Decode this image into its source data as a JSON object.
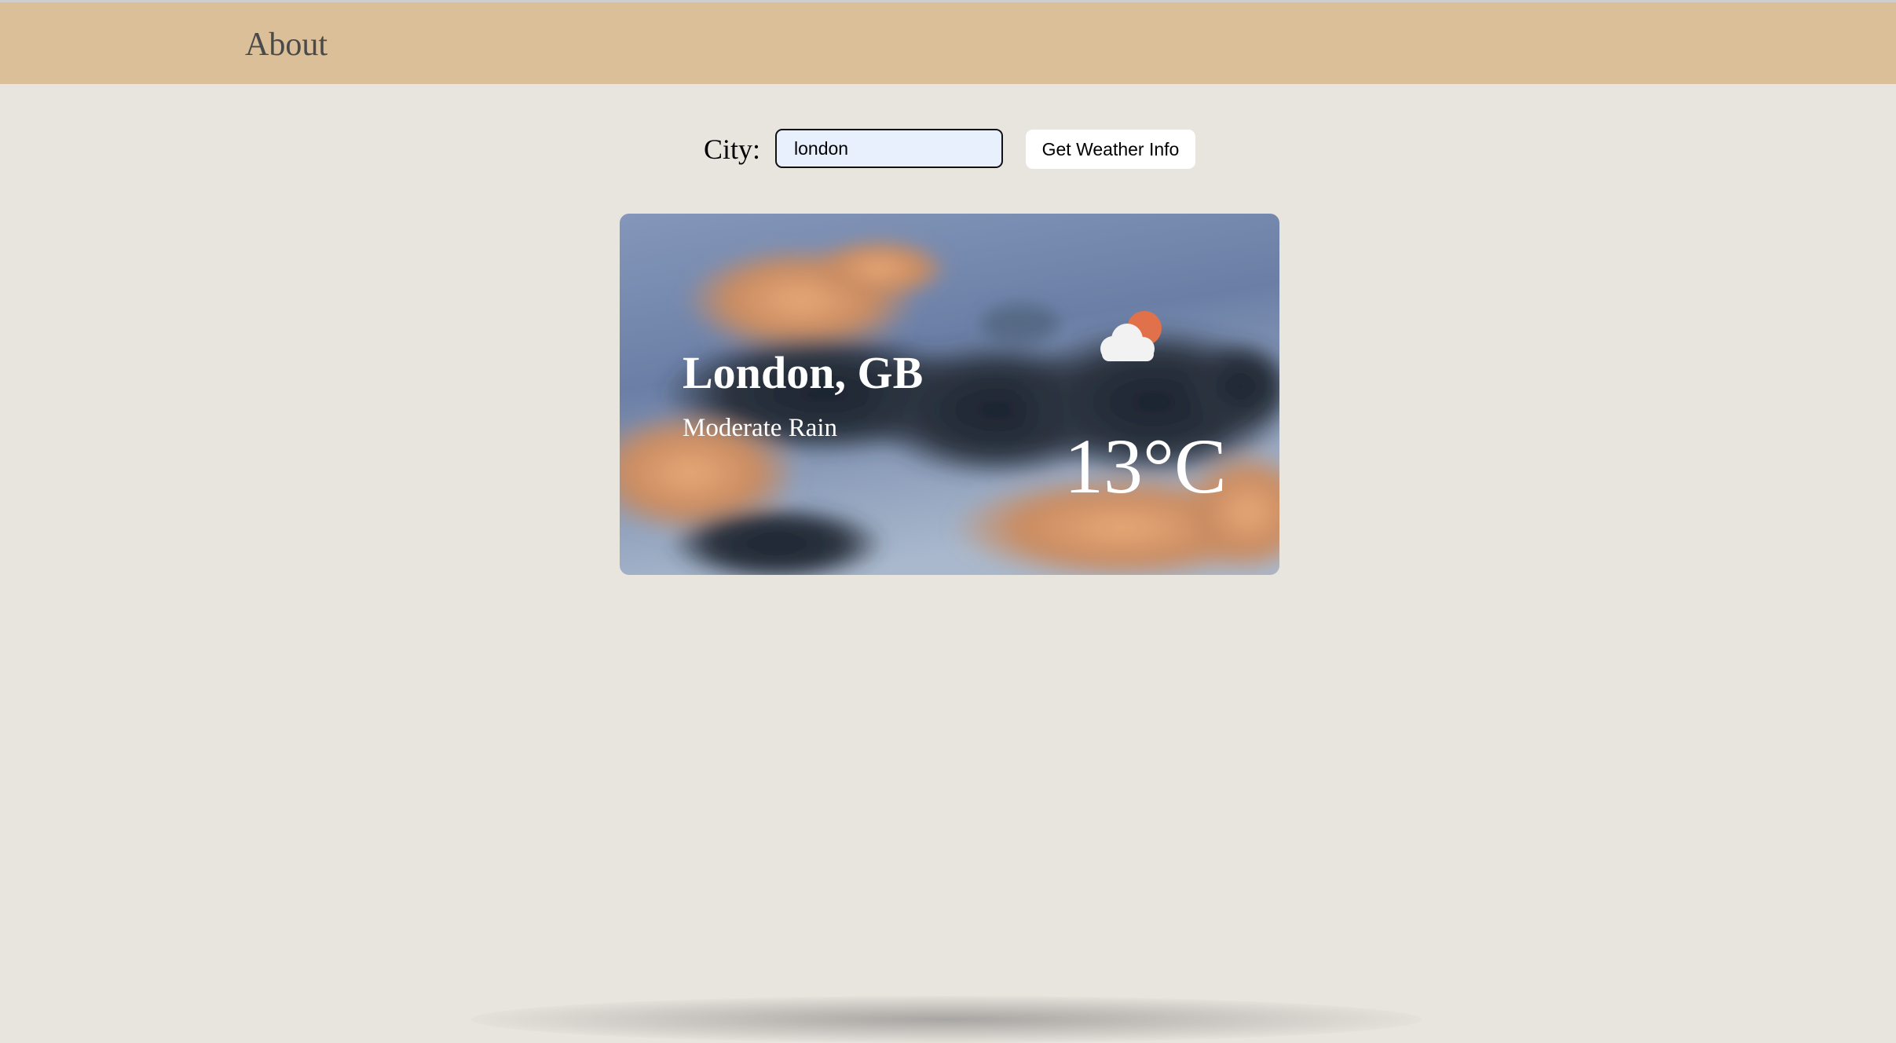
{
  "navbar": {
    "about_label": "About"
  },
  "search": {
    "label": "City:",
    "value": "london",
    "button_label": "Get Weather Info"
  },
  "weather": {
    "location": "London, GB",
    "description": "Moderate Rain",
    "temperature": "13°C",
    "icon": "partly-cloudy-icon"
  },
  "colors": {
    "navbar": "#dbbf98",
    "page_background": "#e8e4de",
    "input_background": "#e8f0fe",
    "sun": "#e0714a"
  }
}
